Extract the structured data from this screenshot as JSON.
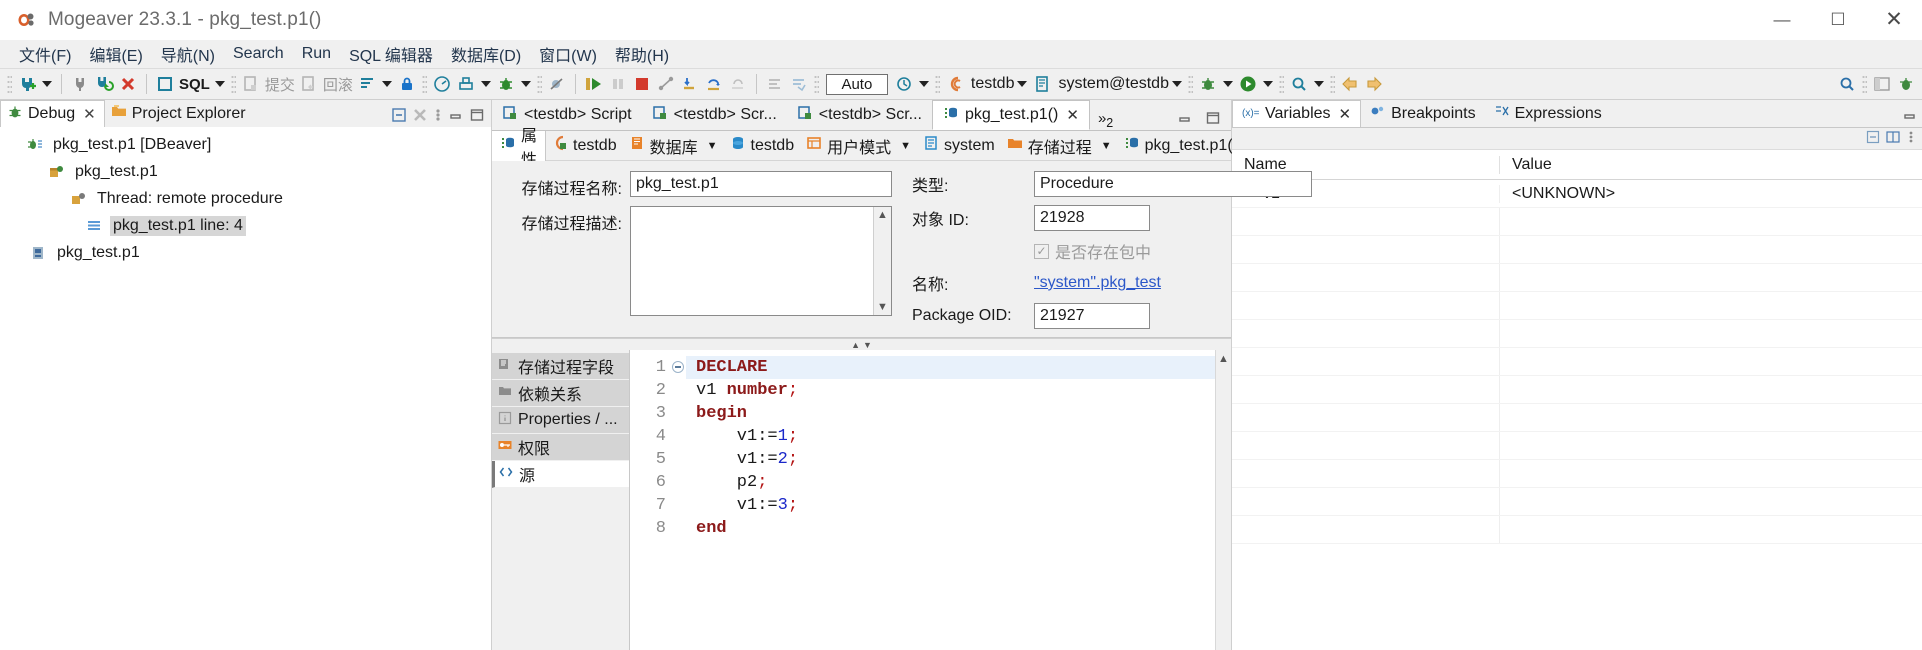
{
  "window": {
    "title": "Mogeaver 23.3.1 - pkg_test.p1()",
    "app_icon": "dbeaver-icon",
    "minimize": "—",
    "maximize": "☐",
    "close": "✕"
  },
  "menubar": {
    "items": [
      {
        "name": "file",
        "label": "文件(F)",
        "mnemonic": "F"
      },
      {
        "name": "edit",
        "label": "编辑(E)",
        "mnemonic": "E"
      },
      {
        "name": "navigate",
        "label": "导航(N)",
        "mnemonic": "N"
      },
      {
        "name": "search",
        "label": "Search",
        "mnemonic": "S"
      },
      {
        "name": "run",
        "label": "Run",
        "mnemonic": "R"
      },
      {
        "name": "sql-editor",
        "label": "SQL 编辑器",
        "mnemonic": "Q"
      },
      {
        "name": "database",
        "label": "数据库(D)",
        "mnemonic": "D"
      },
      {
        "name": "window",
        "label": "窗口(W)",
        "mnemonic": "W"
      },
      {
        "name": "help",
        "label": "帮助(H)",
        "mnemonic": "H"
      }
    ]
  },
  "toolbar": {
    "commit_label": "提交",
    "rollback_label": "回滚",
    "sql_label": "SQL",
    "auto_value": "Auto",
    "connection_label": "testdb",
    "schema_label": "system@testdb",
    "icons": [
      "new-connection-icon",
      "connection-dropdown-caret",
      "disconnect-icon",
      "refresh-connection-icon",
      "reject-connection-icon",
      "sql-editor-icon",
      "sql-dropdown-caret",
      "commit-icon",
      "rollback-icon",
      "transaction-mode-icon",
      "transaction-caret",
      "lock-icon",
      "dashboard-icon",
      "tools-icon",
      "tools-caret",
      "debug-icon",
      "debug-caret",
      "skip-breakpoints-icon",
      "resume-icon",
      "suspend-icon",
      "terminate-icon",
      "disconnect-debug-icon",
      "step-into-icon",
      "step-over-icon",
      "step-return-icon",
      "drop-to-frame-icon",
      "use-step-filters-icon",
      "auto-commit-icon",
      "history-icon",
      "history-caret",
      "database-icon",
      "database-caret",
      "schema-icon",
      "schema-caret",
      "debug-config-icon",
      "debug-config-caret",
      "run-icon",
      "run-caret",
      "search-icon",
      "search-caret",
      "back-icon",
      "forward-icon"
    ]
  },
  "debug_panel": {
    "tabs": [
      {
        "name": "debug",
        "label": "Debug",
        "icon": "bug-icon",
        "active": true,
        "closeable": true
      },
      {
        "name": "project-explorer",
        "label": "Project Explorer",
        "icon": "project-icon",
        "active": false,
        "closeable": false
      }
    ],
    "tools": [
      "collapse-all-icon",
      "remove-all-terminated-icon",
      "view-menu-icon",
      "minimize-icon",
      "maximize-icon"
    ],
    "tree": [
      {
        "indent": 0,
        "twist": "ⱟ",
        "icon": "launch-icon",
        "label": "pkg_test.p1 [DBeaver]",
        "selected": false
      },
      {
        "indent": 1,
        "twist": "ⱟ",
        "icon": "debug-target-icon",
        "label": "pkg_test.p1",
        "selected": false
      },
      {
        "indent": 2,
        "twist": "ⱟ",
        "icon": "thread-icon",
        "label": "Thread: remote procedure",
        "selected": false
      },
      {
        "indent": 3,
        "twist": "",
        "icon": "stack-frame-icon",
        "label": "pkg_test.p1 line: 4",
        "selected": true
      },
      {
        "indent": 1,
        "twist": "",
        "icon": "process-icon",
        "label": "pkg_test.p1",
        "selected": false
      }
    ]
  },
  "editor": {
    "tabs": [
      {
        "name": "testdb-script-1",
        "label": "<testdb> Script",
        "icon": "sql-script-icon",
        "active": false
      },
      {
        "name": "testdb-script-2",
        "label": "<testdb> Scr...",
        "icon": "sql-script-icon",
        "active": false
      },
      {
        "name": "testdb-script-3",
        "label": "<testdb> Scr...",
        "icon": "sql-script-icon",
        "active": false
      },
      {
        "name": "pkg-test-p1",
        "label": "pkg_test.p1()",
        "icon": "procedure-icon",
        "active": true
      }
    ],
    "overflow_label": "»",
    "overflow_count": "2",
    "tools": [
      "minimize-icon",
      "maximize-icon"
    ],
    "properties_tab": {
      "label": "属性",
      "icon": "properties-icon"
    },
    "breadcrumbs": [
      {
        "name": "connection",
        "label": "testdb",
        "icon": "connection-icon",
        "caret": false
      },
      {
        "name": "databases-folder",
        "label": "数据库",
        "icon": "folder-db-icon",
        "caret": true
      },
      {
        "name": "database",
        "label": "testdb",
        "icon": "database-icon",
        "caret": false
      },
      {
        "name": "user-schemas",
        "label": "用户模式",
        "icon": "schemas-icon",
        "caret": true
      },
      {
        "name": "schema",
        "label": "system",
        "icon": "schema-icon",
        "caret": false
      },
      {
        "name": "procedures-folder",
        "label": "存储过程",
        "icon": "folder-orange-icon",
        "caret": true
      },
      {
        "name": "procedure",
        "label": "pkg_test.p1()",
        "icon": "procedure-icon",
        "caret": false
      }
    ],
    "form": {
      "name_label": "存储过程名称:",
      "name_value": "pkg_test.p1",
      "description_label": "存储过程描述:",
      "description_value": "",
      "type_label": "类型:",
      "type_value": "Procedure",
      "object_id_label": "对象 ID:",
      "object_id_value": "21928",
      "in_package_label": "是否存在包中",
      "in_package_checked": true,
      "package_name_label": "名称:",
      "package_name_value": "\"system\".pkg_test",
      "package_oid_label": "Package OID:",
      "package_oid_value": "21927"
    },
    "side_tabs": [
      {
        "name": "procedure-columns",
        "label": "存储过程字段",
        "icon": "columns-icon",
        "active": false
      },
      {
        "name": "dependencies",
        "label": "依赖关系",
        "icon": "folder-icon",
        "active": false
      },
      {
        "name": "properties-info",
        "label": "Properties / ...",
        "icon": "info-icon",
        "active": false
      },
      {
        "name": "permissions",
        "label": "权限",
        "icon": "key-icon",
        "active": false
      },
      {
        "name": "source",
        "label": "源",
        "icon": "source-icon",
        "active": true
      }
    ],
    "source_code": [
      {
        "num": "1",
        "folded": true,
        "highlight": true,
        "parts": [
          {
            "t": "DECLARE",
            "c": "kw"
          }
        ],
        "indent": 1
      },
      {
        "num": "2",
        "folded": false,
        "highlight": false,
        "parts": [
          {
            "t": "v1 ",
            "c": ""
          },
          {
            "t": "number",
            "c": "kw"
          },
          {
            "t": ";",
            "c": "punct"
          }
        ],
        "indent": 0
      },
      {
        "num": "3",
        "folded": false,
        "highlight": false,
        "parts": [
          {
            "t": "begin",
            "c": "kw"
          }
        ],
        "indent": 0
      },
      {
        "num": "4",
        "folded": false,
        "highlight": false,
        "parts": [
          {
            "t": "    v1:=",
            "c": ""
          },
          {
            "t": "1",
            "c": "num"
          },
          {
            "t": ";",
            "c": "punct"
          }
        ],
        "indent": 0
      },
      {
        "num": "5",
        "folded": false,
        "highlight": false,
        "parts": [
          {
            "t": "    v1:=",
            "c": ""
          },
          {
            "t": "2",
            "c": "num"
          },
          {
            "t": ";",
            "c": "punct"
          }
        ],
        "indent": 0
      },
      {
        "num": "6",
        "folded": false,
        "highlight": false,
        "parts": [
          {
            "t": "    p2",
            "c": ""
          },
          {
            "t": ";",
            "c": "punct"
          }
        ],
        "indent": 0
      },
      {
        "num": "7",
        "folded": false,
        "highlight": false,
        "parts": [
          {
            "t": "    v1:=",
            "c": ""
          },
          {
            "t": "3",
            "c": "num"
          },
          {
            "t": ";",
            "c": "punct"
          }
        ],
        "indent": 0
      },
      {
        "num": "8",
        "folded": false,
        "highlight": false,
        "parts": [
          {
            "t": "end",
            "c": "kw"
          }
        ],
        "indent": 0
      }
    ]
  },
  "variables_panel": {
    "tabs": [
      {
        "name": "variables",
        "label": "Variables",
        "icon": "variables-icon",
        "active": true,
        "closeable": true
      },
      {
        "name": "breakpoints",
        "label": "Breakpoints",
        "icon": "breakpoint-icon",
        "active": false,
        "closeable": false
      },
      {
        "name": "expressions",
        "label": "Expressions",
        "icon": "expressions-icon",
        "active": false,
        "closeable": false
      }
    ],
    "tools": [
      "minimize-icon",
      "maximize-icon"
    ],
    "row_tools": [
      "collapse-all-icon",
      "layout-icon",
      "view-menu-icon"
    ],
    "columns": [
      "Name",
      "Value"
    ],
    "rows": [
      {
        "name": "v1",
        "value": "<UNKNOWN>",
        "icon": "variable-icon"
      }
    ],
    "empty_rows": 11
  },
  "colors": {
    "accent_blue": "#2b57c9",
    "keyword_red": "#8c1a1a",
    "number_blue": "#1a27c9",
    "punct_red": "#b31414",
    "selection_gray": "#d6d6d6",
    "line_highlight": "#e8f1fb",
    "chrome_gray": "#f0f0f0"
  }
}
